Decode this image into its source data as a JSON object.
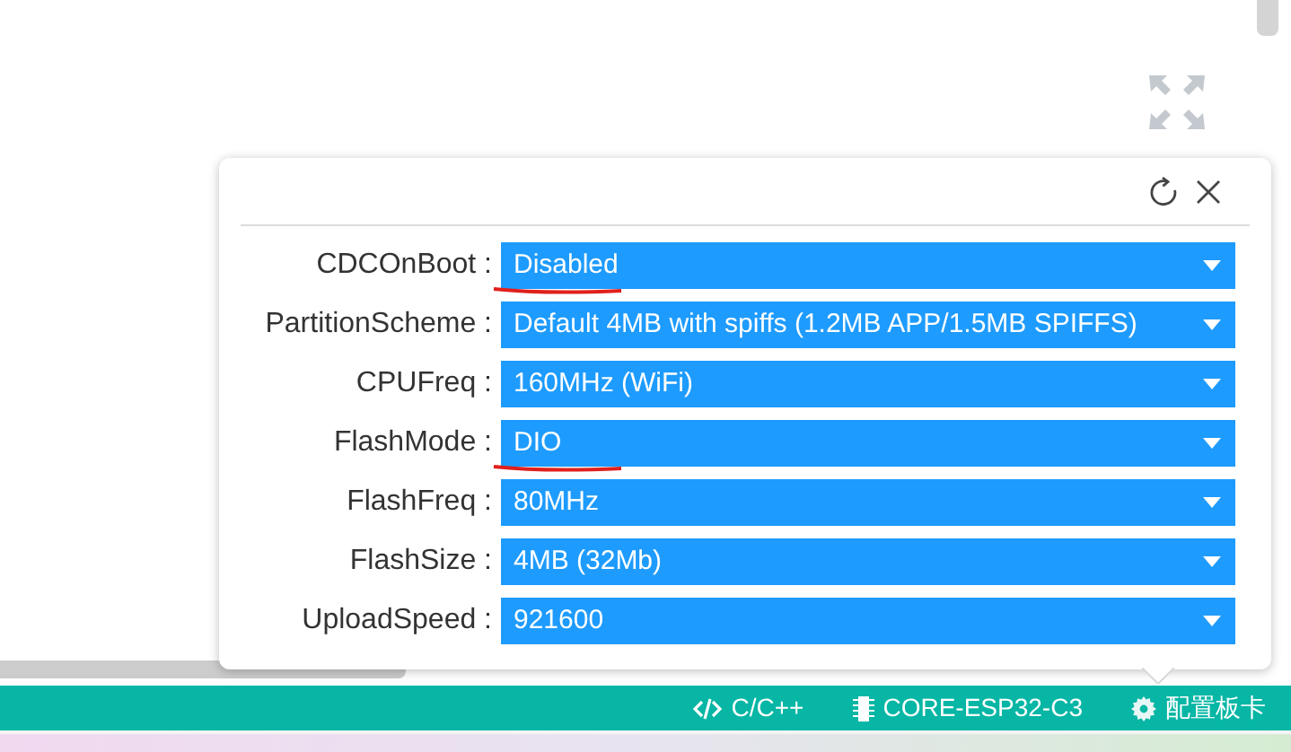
{
  "settings_popup": {
    "rows": [
      {
        "label": "CDCOnBoot :",
        "value": "Disabled",
        "annotated": true
      },
      {
        "label": "PartitionScheme :",
        "value": "Default 4MB with spiffs (1.2MB APP/1.5MB SPIFFS)",
        "annotated": false
      },
      {
        "label": "CPUFreq :",
        "value": "160MHz (WiFi)",
        "annotated": false
      },
      {
        "label": "FlashMode :",
        "value": "DIO",
        "annotated": true
      },
      {
        "label": "FlashFreq :",
        "value": "80MHz",
        "annotated": false
      },
      {
        "label": "FlashSize :",
        "value": "4MB (32Mb)",
        "annotated": false
      },
      {
        "label": "UploadSpeed :",
        "value": "921600",
        "annotated": false
      }
    ]
  },
  "status_bar": {
    "items": [
      {
        "kind": "code",
        "label": "C/C++"
      },
      {
        "kind": "chip",
        "label": "CORE-ESP32-C3"
      },
      {
        "kind": "gear",
        "label": "配置板卡"
      }
    ]
  }
}
